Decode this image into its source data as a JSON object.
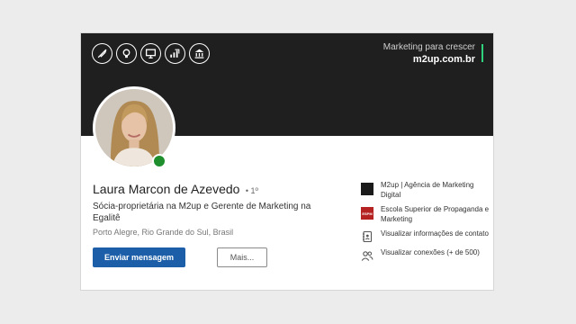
{
  "banner": {
    "icons": [
      "rocket-launch-icon",
      "lightbulb-icon",
      "monitor-chart-icon",
      "growth-chart-icon",
      "bank-icon"
    ],
    "tagline": "Marketing para crescer",
    "domain": "m2up.com.br",
    "accent_color": "#2fd17a"
  },
  "profile": {
    "name": "Laura Marcon de Azevedo",
    "degree": "• 1º",
    "headline": "Sócia-proprietária na M2up e Gerente de Marketing na Egalitê",
    "location": "Porto Alegre, Rio Grande do Sul, Brasil",
    "status": "online",
    "status_color": "#1f8f2d"
  },
  "actions": {
    "message_label": "Enviar mensagem",
    "more_label": "Mais...",
    "primary_color": "#1c5fa8"
  },
  "sidebar": {
    "items": [
      {
        "icon": "m2up-logo",
        "label": "M2up | Agência de Marketing Digital"
      },
      {
        "icon": "espm-logo",
        "logo_text": "ESPM",
        "label": "Escola Superior de Propaganda e Marketing"
      },
      {
        "icon": "contact-book-icon",
        "label": "Visualizar informações de contato"
      },
      {
        "icon": "people-icon",
        "label": "Visualizar conexões (+ de 500)"
      }
    ]
  }
}
